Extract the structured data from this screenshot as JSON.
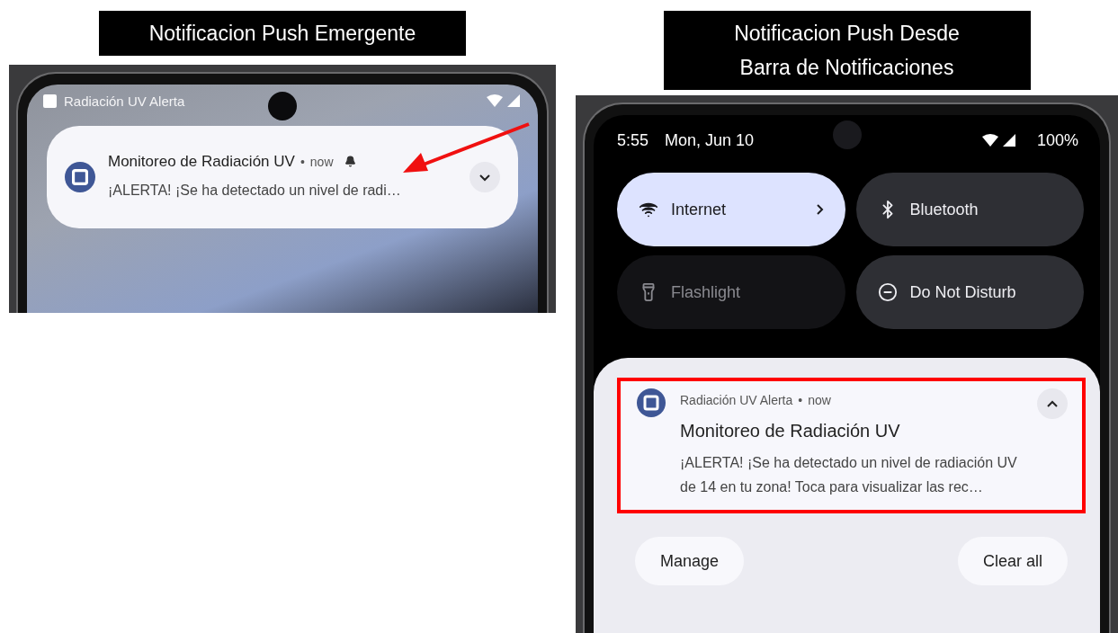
{
  "heads_up": {
    "caption": "Notificacion Push Emergente",
    "status_bar": {
      "app_label": "Radiación UV Alerta"
    },
    "notification": {
      "title": "Monitoreo de Radiación UV",
      "separator": "•",
      "time": "now",
      "text": "¡ALERTA! ¡Se ha detectado un nivel de radi…",
      "alerting": true,
      "expanded": false
    }
  },
  "notification_shade": {
    "caption_lines": [
      "Notificacion Push Desde",
      "Barra de Notificaciones"
    ],
    "status_bar": {
      "time": "5:55",
      "date": "Mon, Jun 10",
      "battery": "100%"
    },
    "tiles": [
      {
        "label": "Internet",
        "on": true,
        "disabled": false,
        "expandable": true
      },
      {
        "label": "Bluetooth",
        "on": false,
        "disabled": false,
        "expandable": false
      },
      {
        "label": "Flashlight",
        "on": false,
        "disabled": true,
        "expandable": false
      },
      {
        "label": "Do Not Disturb",
        "on": false,
        "disabled": false,
        "expandable": false
      }
    ],
    "notification": {
      "app_name": "Radiación UV Alerta",
      "separator": "•",
      "time": "now",
      "title": "Monitoreo de Radiación UV",
      "text": "¡ALERTA! ¡Se ha detectado un nivel de radiación UV de 14 en tu zona! Toca para visualizar las rec…",
      "expanded": true,
      "highlighted": true
    },
    "buttons": [
      "Manage",
      "Clear all"
    ]
  }
}
